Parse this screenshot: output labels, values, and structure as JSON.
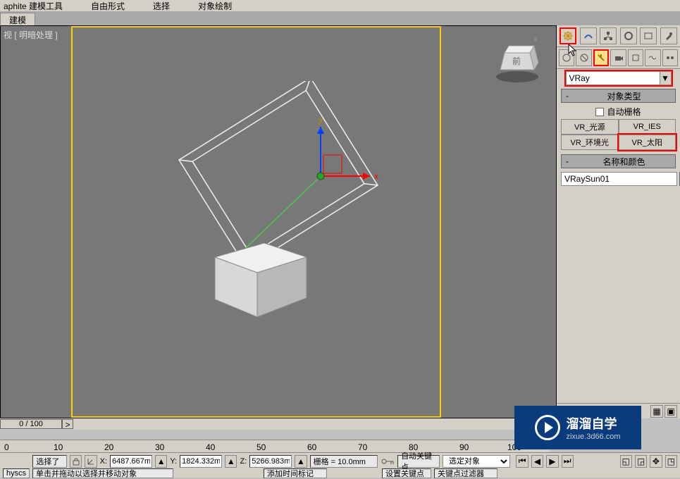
{
  "menubar": {
    "item0": "aphite 建模工具",
    "item1": "自由形式",
    "item2": "选择",
    "item3": "对象绘制"
  },
  "tabbar": {
    "tab0": "建模"
  },
  "viewport": {
    "label": "视 [ 明暗处理 ]",
    "cubeface": "前"
  },
  "gizmo": {
    "x": "x",
    "y": "y",
    "z": "z"
  },
  "cmdpanel": {
    "category_dropdown": "VRay",
    "roll_objtype": {
      "minus": "-",
      "title": "对象类型"
    },
    "autogrid_label": "自动栅格",
    "buttons": {
      "b0": "VR_光源",
      "b1": "VR_IES",
      "b2": "VR_环境光",
      "b3": "VR_太阳"
    },
    "roll_namecolor": {
      "minus": "-",
      "title": "名称和颜色"
    },
    "name_value": "VRaySun01"
  },
  "timeslider": {
    "label": "0 / 100",
    "arrow": ">"
  },
  "ruler": {
    "t0": "0",
    "t10": "10",
    "t20": "20",
    "t30": "30",
    "t40": "40",
    "t50": "50",
    "t60": "60",
    "t70": "70",
    "t80": "80",
    "t90": "90",
    "t100": "100"
  },
  "statusbar": {
    "selected": "选择了",
    "x_label": "X:",
    "x_val": "6487.667m",
    "y_label": "Y:",
    "y_val": "1824.332m",
    "z_label": "Z:",
    "z_val": "5266.983m",
    "grid": "栅格 = 10.0mm",
    "autokey": "自动关键点",
    "keyselect": "选定对象"
  },
  "statusbar2": {
    "left": "hyscs",
    "hint": "单击并拖动以选择并移动对象",
    "addtime": "添加时间标记",
    "setkey": "设置关键点",
    "keyfilter": "关键点过滤器"
  },
  "watermark": {
    "brand": "溜溜自学",
    "url": "zixue.3d66.com"
  }
}
